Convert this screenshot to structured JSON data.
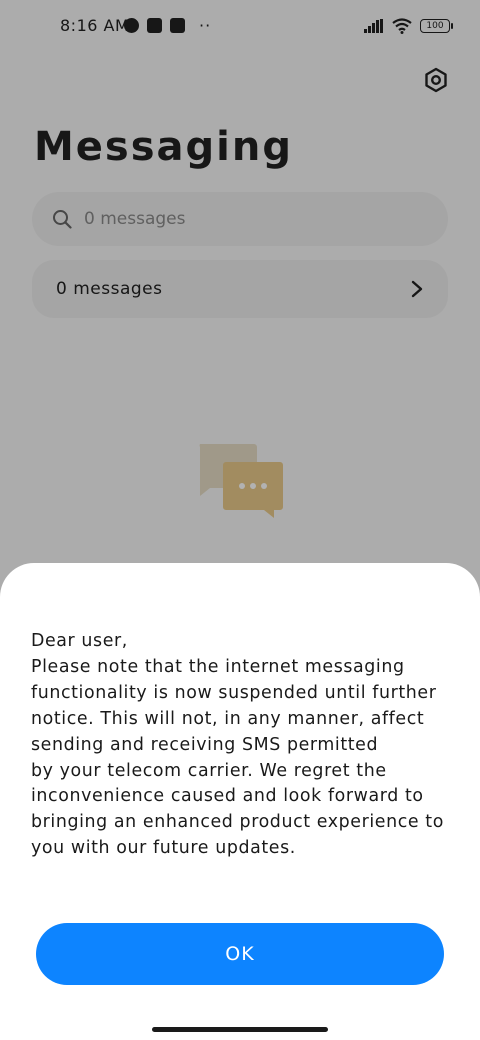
{
  "status_bar": {
    "time": "8:16 AM",
    "battery": "100"
  },
  "header": {
    "title": "Messaging",
    "settings_icon": "gear-icon"
  },
  "search": {
    "placeholder": "0 messages",
    "icon": "search-icon"
  },
  "messages_row": {
    "label": "0 messages",
    "icon": "chevron-right-icon"
  },
  "dialog": {
    "lines": [
      "Dear user,",
      "Please note that the internet messaging",
      "functionality is now suspended until further",
      "notice. This will not, in any manner, affect",
      "sending and receiving SMS permitted",
      "by your telecom carrier. We regret the",
      "inconvenience caused and look forward to",
      "bringing an enhanced product experience to",
      "you with our future updates."
    ],
    "ok_label": "OK"
  },
  "colors": {
    "accent": "#0d84ff",
    "overlay": "rgba(0,0,0,0.30)",
    "illustration_back": "#e5dcc4",
    "illustration_front": "#e8c98a"
  }
}
